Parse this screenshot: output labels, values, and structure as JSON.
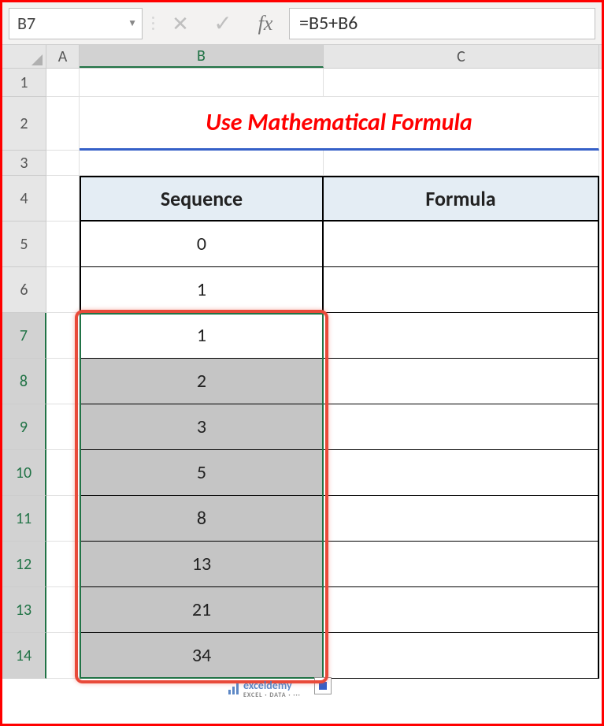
{
  "formula_bar": {
    "name_box": "B7",
    "fx_label": "fx",
    "formula": "=B5+B6"
  },
  "columns": [
    "A",
    "B",
    "C"
  ],
  "rows": [
    "1",
    "2",
    "3",
    "4",
    "5",
    "6",
    "7",
    "8",
    "9",
    "10",
    "11",
    "12",
    "13",
    "14"
  ],
  "active_column": "B",
  "active_row": "7",
  "title": "Use Mathematical Formula",
  "table": {
    "header_sequence": "Sequence",
    "header_formula": "Formula"
  },
  "chart_data": {
    "type": "table",
    "title": "Use Mathematical Formula",
    "columns": [
      "Sequence",
      "Formula"
    ],
    "rows": [
      {
        "Sequence": 0,
        "Formula": ""
      },
      {
        "Sequence": 1,
        "Formula": ""
      },
      {
        "Sequence": 1,
        "Formula": ""
      },
      {
        "Sequence": 2,
        "Formula": ""
      },
      {
        "Sequence": 3,
        "Formula": ""
      },
      {
        "Sequence": 5,
        "Formula": ""
      },
      {
        "Sequence": 8,
        "Formula": ""
      },
      {
        "Sequence": 13,
        "Formula": ""
      },
      {
        "Sequence": 21,
        "Formula": ""
      },
      {
        "Sequence": 34,
        "Formula": ""
      }
    ],
    "selection": {
      "col": "B",
      "rows_from": 7,
      "rows_to": 14
    },
    "active_cell_formula": "=B5+B6"
  },
  "watermark": {
    "text": "exceldemy",
    "sub": "EXCEL · DATA · ···"
  }
}
